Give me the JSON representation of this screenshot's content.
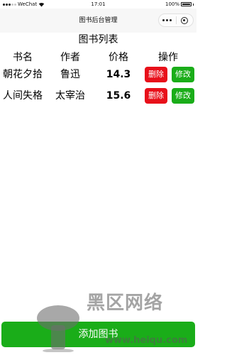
{
  "status_bar": {
    "carrier": "WeChat",
    "time": "17:01",
    "battery": "100%"
  },
  "nav": {
    "title": "图书后台管理"
  },
  "page": {
    "title": "图书列表"
  },
  "table": {
    "headers": [
      "书名",
      "作者",
      "价格",
      "操作"
    ],
    "rows": [
      {
        "name": "朝花夕拾",
        "author": "鲁迅",
        "price": "14.3",
        "delete_label": "删除",
        "edit_label": "修改"
      },
      {
        "name": "人间失格",
        "author": "太宰治",
        "price": "15.6",
        "delete_label": "删除",
        "edit_label": "修改"
      }
    ]
  },
  "footer": {
    "add_label": "添加图书"
  },
  "watermark": {
    "text": "黑区网络",
    "url": "www.heiqu.com"
  },
  "colors": {
    "delete": "#e8101a",
    "edit": "#1aad19",
    "add": "#1aad19",
    "nav_bg": "#f7f7f7"
  },
  "icons": [
    "signal-dots-icon",
    "wifi-icon",
    "battery-icon",
    "more-icon",
    "close-circle-icon"
  ]
}
